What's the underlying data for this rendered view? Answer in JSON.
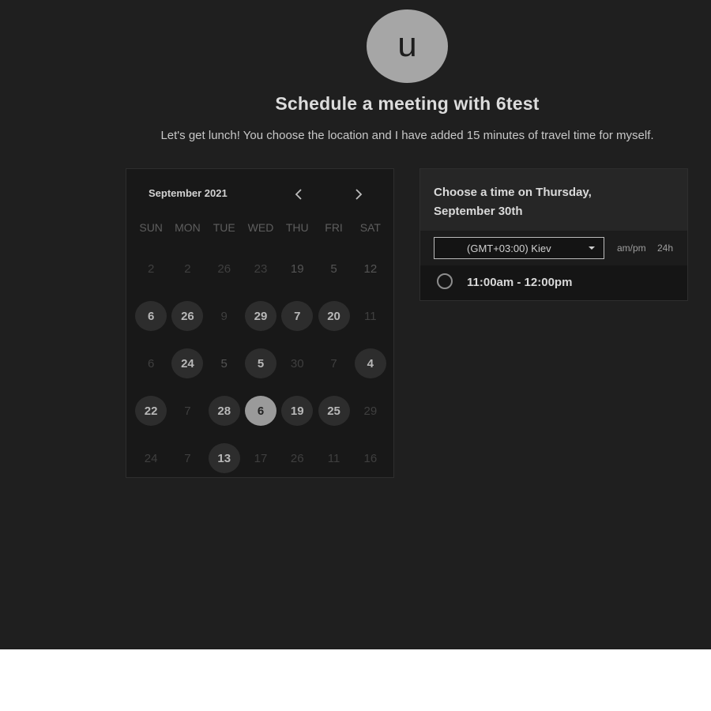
{
  "host": {
    "avatar_initial": "u",
    "title": "Schedule a meeting with 6test",
    "description": "Let's get lunch! You choose the location and I have added 15 minutes of travel time for myself."
  },
  "calendar": {
    "month_label": "September 2021",
    "prev_icon": "chevron-left-icon",
    "next_icon": "chevron-right-icon",
    "weekdays": [
      "SUN",
      "MON",
      "TUE",
      "WED",
      "THU",
      "FRI",
      "SAT"
    ],
    "weeks": [
      [
        {
          "label": "2",
          "state": "disabled"
        },
        {
          "label": "2",
          "state": "disabled"
        },
        {
          "label": "26",
          "state": "disabled"
        },
        {
          "label": "23",
          "state": "disabled"
        },
        {
          "label": "19",
          "state": "muted"
        },
        {
          "label": "5",
          "state": "muted"
        },
        {
          "label": "12",
          "state": "muted"
        }
      ],
      [
        {
          "label": "6",
          "state": "available"
        },
        {
          "label": "26",
          "state": "available"
        },
        {
          "label": "9",
          "state": "disabled"
        },
        {
          "label": "29",
          "state": "available"
        },
        {
          "label": "7",
          "state": "available"
        },
        {
          "label": "20",
          "state": "available"
        },
        {
          "label": "11",
          "state": "disabled"
        }
      ],
      [
        {
          "label": "6",
          "state": "disabled"
        },
        {
          "label": "24",
          "state": "available"
        },
        {
          "label": "5",
          "state": "muted"
        },
        {
          "label": "5",
          "state": "available"
        },
        {
          "label": "30",
          "state": "disabled"
        },
        {
          "label": "7",
          "state": "disabled"
        },
        {
          "label": "4",
          "state": "available"
        }
      ],
      [
        {
          "label": "22",
          "state": "available"
        },
        {
          "label": "7",
          "state": "disabled"
        },
        {
          "label": "28",
          "state": "available"
        },
        {
          "label": "6",
          "state": "selected"
        },
        {
          "label": "19",
          "state": "available"
        },
        {
          "label": "25",
          "state": "available"
        },
        {
          "label": "29",
          "state": "disabled"
        }
      ],
      [
        {
          "label": "24",
          "state": "disabled"
        },
        {
          "label": "7",
          "state": "disabled"
        },
        {
          "label": "13",
          "state": "available"
        },
        {
          "label": "17",
          "state": "disabled"
        },
        {
          "label": "26",
          "state": "disabled"
        },
        {
          "label": "11",
          "state": "disabled"
        },
        {
          "label": "16",
          "state": "disabled"
        }
      ]
    ]
  },
  "time_panel": {
    "heading": "Choose a time on Thursday, September 30th",
    "timezone_value": "(GMT+03:00) Kiev",
    "timezone_icon": "caret-down-icon",
    "format_ampm": "am/pm",
    "format_24h": "24h",
    "slots": [
      {
        "label": "11:00am - 12:00pm",
        "icon": "radio-circle-icon"
      }
    ]
  },
  "colors": {
    "background": "#1f1f1f",
    "card": "#181818",
    "available_day": "#2d2d2d",
    "selected_day": "#9a9a9a",
    "avatar": "#a6a6a6"
  }
}
